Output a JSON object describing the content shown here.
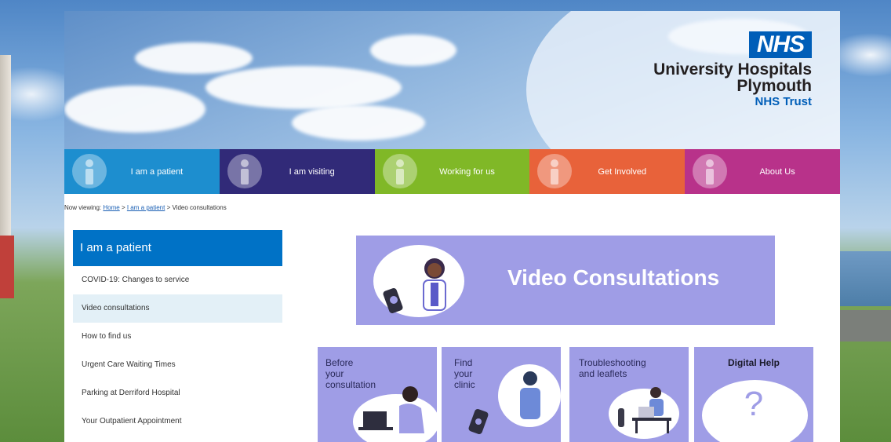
{
  "header": {
    "logo_text": "NHS",
    "org_line1": "University Hospitals",
    "org_line2": "Plymouth",
    "org_trust": "NHS Trust"
  },
  "nav": [
    {
      "label": "I am a patient",
      "color": "#1d8ecf"
    },
    {
      "label": "I am visiting",
      "color": "#312a78"
    },
    {
      "label": "Working for us",
      "color": "#80b827"
    },
    {
      "label": "Get Involved",
      "color": "#e8623a"
    },
    {
      "label": "About Us",
      "color": "#b8328a"
    }
  ],
  "breadcrumb": {
    "prefix": "Now viewing:",
    "home": "Home",
    "sep": ">",
    "patient": "I am a patient",
    "current": "Video consultations"
  },
  "sidebar": {
    "title": "I am a patient",
    "items": [
      {
        "label": "COVID-19: Changes to service"
      },
      {
        "label": "Video consultations"
      },
      {
        "label": "How to find us"
      },
      {
        "label": "Urgent Care Waiting Times"
      },
      {
        "label": "Parking at Derriford Hospital"
      },
      {
        "label": "Your Outpatient Appointment"
      }
    ]
  },
  "banner": {
    "title": "Video Consultations",
    "color": "#9f9de6"
  },
  "tiles": [
    {
      "line1": "Before",
      "line2": "your",
      "line3": "consultation"
    },
    {
      "line1": "Find",
      "line2": "your",
      "line3": "clinic"
    },
    {
      "line1": "Troubleshooting",
      "line2": "and leaflets"
    },
    {
      "line1": "Digital Help",
      "symbol": "?"
    }
  ]
}
